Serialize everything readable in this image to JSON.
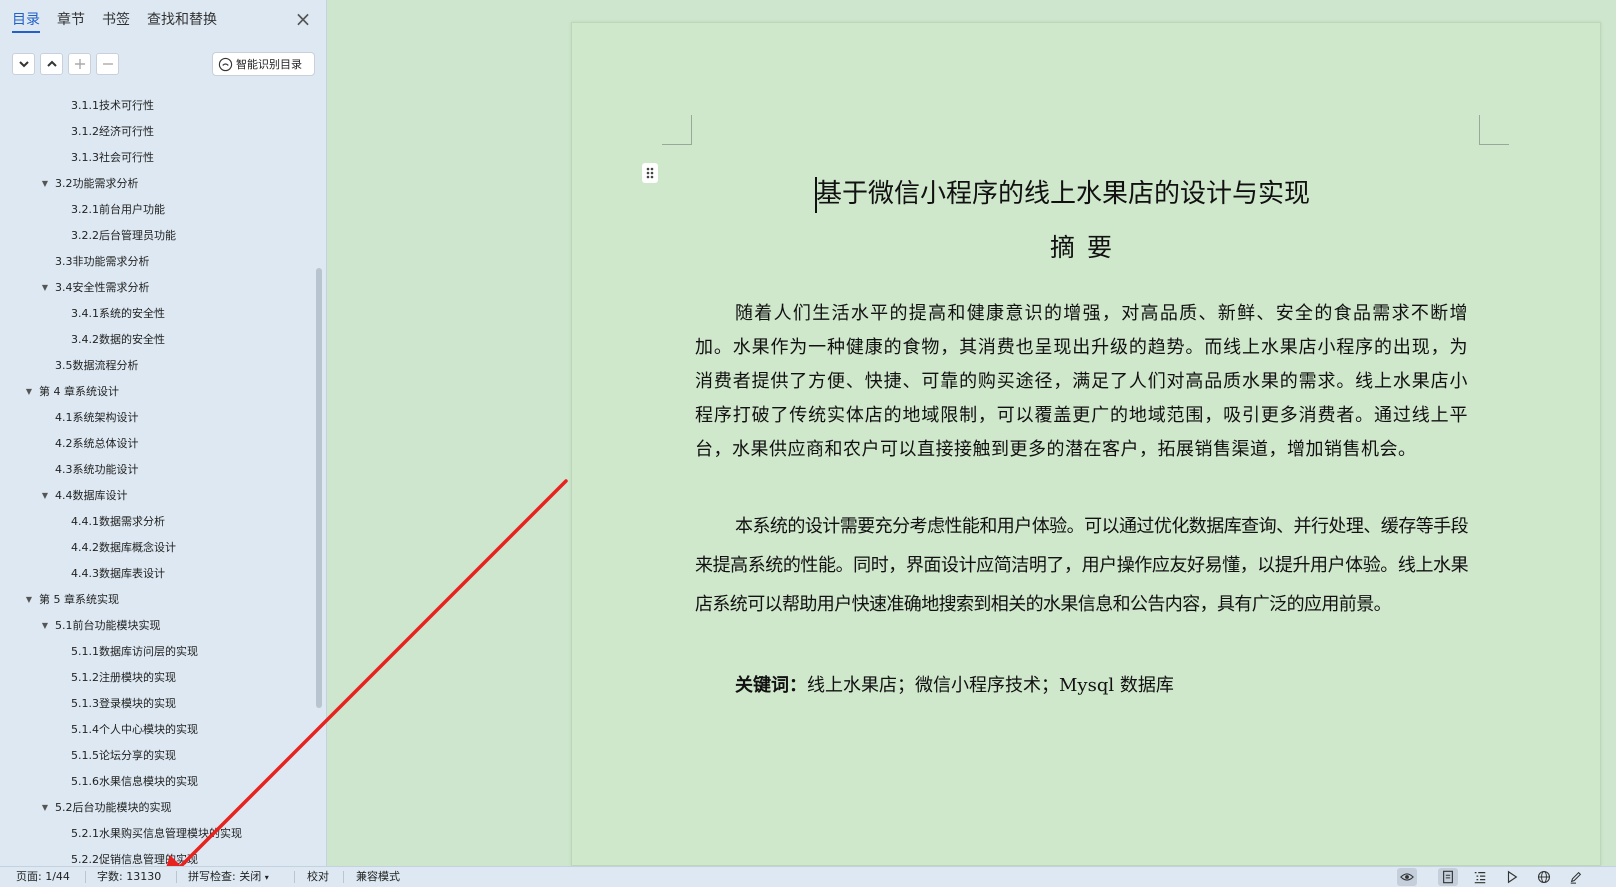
{
  "nav": {
    "tabs": [
      "目录",
      "章节",
      "书签",
      "查找和替换"
    ],
    "active_tab": "目录",
    "smart_toc_label": "智能识别目录",
    "toc": [
      {
        "label": "3.1.1技术可行性",
        "level": 2,
        "expanded": null
      },
      {
        "label": "3.1.2经济可行性",
        "level": 2,
        "expanded": null
      },
      {
        "label": "3.1.3社会可行性",
        "level": 2,
        "expanded": null
      },
      {
        "label": "3.2功能需求分析",
        "level": 1,
        "expanded": true
      },
      {
        "label": "3.2.1前台用户功能",
        "level": 2,
        "expanded": null
      },
      {
        "label": "3.2.2后台管理员功能",
        "level": 2,
        "expanded": null
      },
      {
        "label": "3.3非功能需求分析",
        "level": 1,
        "expanded": null
      },
      {
        "label": "3.4安全性需求分析",
        "level": 1,
        "expanded": true
      },
      {
        "label": "3.4.1系统的安全性",
        "level": 2,
        "expanded": null
      },
      {
        "label": "3.4.2数据的安全性",
        "level": 2,
        "expanded": null
      },
      {
        "label": "3.5数据流程分析",
        "level": 1,
        "expanded": null
      },
      {
        "label": "第 4 章系统设计",
        "level": 0,
        "expanded": true
      },
      {
        "label": "4.1系统架构设计",
        "level": 1,
        "expanded": null
      },
      {
        "label": "4.2系统总体设计",
        "level": 1,
        "expanded": null
      },
      {
        "label": "4.3系统功能设计",
        "level": 1,
        "expanded": null
      },
      {
        "label": "4.4数据库设计",
        "level": 1,
        "expanded": true
      },
      {
        "label": "4.4.1数据需求分析",
        "level": 2,
        "expanded": null
      },
      {
        "label": "4.4.2数据库概念设计",
        "level": 2,
        "expanded": null
      },
      {
        "label": "4.4.3数据库表设计",
        "level": 2,
        "expanded": null
      },
      {
        "label": "第 5 章系统实现",
        "level": 0,
        "expanded": true
      },
      {
        "label": "5.1前台功能模块实现",
        "level": 1,
        "expanded": true
      },
      {
        "label": "5.1.1数据库访问层的实现",
        "level": 2,
        "expanded": null
      },
      {
        "label": "5.1.2注册模块的实现",
        "level": 2,
        "expanded": null
      },
      {
        "label": "5.1.3登录模块的实现",
        "level": 2,
        "expanded": null
      },
      {
        "label": "5.1.4个人中心模块的实现",
        "level": 2,
        "expanded": null
      },
      {
        "label": "5.1.5论坛分享的实现",
        "level": 2,
        "expanded": null
      },
      {
        "label": "5.1.6水果信息模块的实现",
        "level": 2,
        "expanded": null
      },
      {
        "label": "5.2后台功能模块的实现",
        "level": 1,
        "expanded": true
      },
      {
        "label": "5.2.1水果购买信息管理模块的实现",
        "level": 2,
        "expanded": null
      },
      {
        "label": "5.2.2促销信息管理的实现",
        "level": 2,
        "expanded": null
      }
    ]
  },
  "document": {
    "title": "基于微信小程序的线上水果店的设计与实现",
    "abstract_heading": "摘要",
    "paragraph_1": "随着人们生活水平的提高和健康意识的增强，对高品质、新鲜、安全的食品需求不断增加。水果作为一种健康的食物，其消费也呈现出升级的趋势。而线上水果店小程序的出现，为消费者提供了方便、快捷、可靠的购买途径，满足了人们对高品质水果的需求。线上水果店小程序打破了传统实体店的地域限制，可以覆盖更广的地域范围，吸引更多消费者。通过线上平台，水果供应商和农户可以直接接触到更多的潜在客户，拓展销售渠道，增加销售机会。",
    "paragraph_2": "本系统的设计需要充分考虑性能和用户体验。可以通过优化数据库查询、并行处理、缓存等手段来提高系统的性能。同时，界面设计应简洁明了，用户操作应友好易懂，以提升用户体验。线上水果店系统可以帮助用户快速准确地搜索到相关的水果信息和公告内容，具有广泛的应用前景。",
    "keywords_label": "关键词：",
    "keywords_value": "线上水果店；微信小程序技术；Mysql 数据库"
  },
  "status_bar": {
    "page": "页面: 1/44",
    "word_count": "字数: 13130",
    "spell_check": "拼写检查: 关闭",
    "proofread": "校对",
    "compat_mode": "兼容模式"
  },
  "colors": {
    "accent": "#2361c9",
    "page_background": "#cfe7cb",
    "annotation_arrow": "#e8231f"
  },
  "icons": [
    "chevron-down-icon",
    "chevron-up-icon",
    "plus-icon",
    "minus-icon",
    "smart-recognize-icon",
    "close-icon",
    "drag-handle-icon",
    "eye-icon",
    "page-view-icon",
    "outline-view-icon",
    "play-icon",
    "globe-icon",
    "pen-icon"
  ]
}
